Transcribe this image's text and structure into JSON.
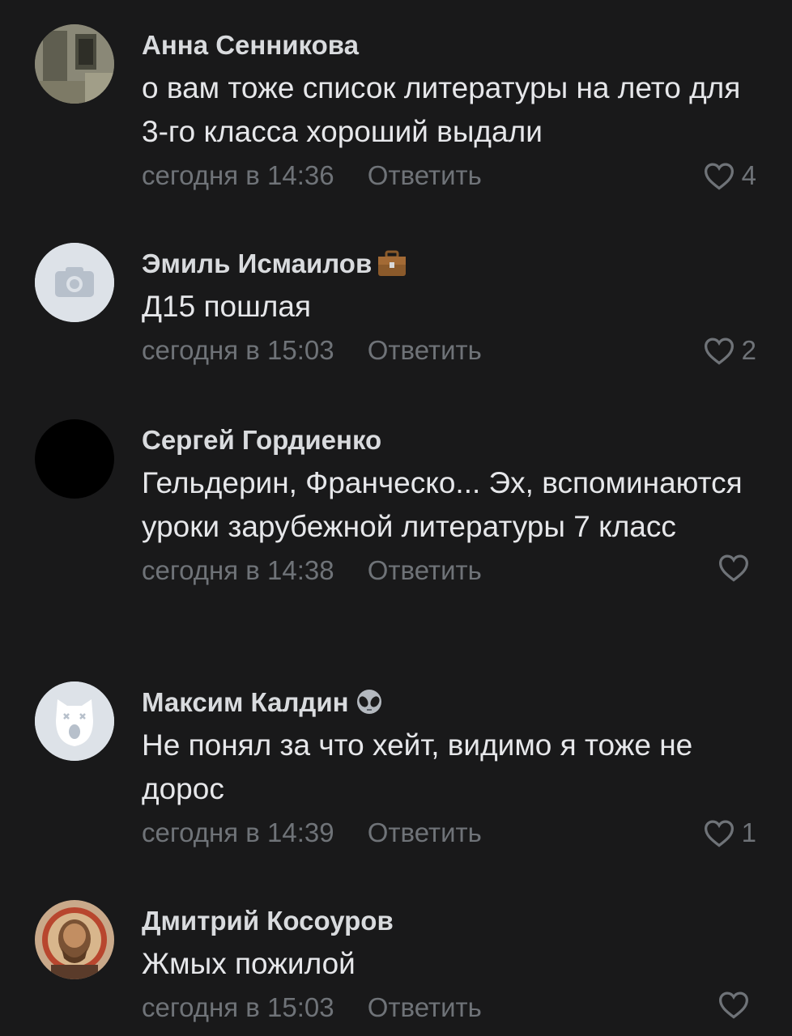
{
  "comments": [
    {
      "author": "Анна Сенникова",
      "text": "о вам тоже список литературы на лето для 3-го класса хороший выдали",
      "time": "сегодня в 14:36",
      "reply": "Ответить",
      "likes": "4",
      "avatar": "photo"
    },
    {
      "author": "Эмиль Исмаилов",
      "badge": "briefcase",
      "text": "Д15 пошлая",
      "time": "сегодня в 15:03",
      "reply": "Ответить",
      "likes": "2",
      "avatar": "camera-placeholder"
    },
    {
      "author": "Сергей Гордиенко",
      "text": "Гельдерин, Франческо... Эх, вспоминаются уроки зарубежной литературы 7 класс",
      "time": "сегодня в 14:38",
      "reply": "Ответить",
      "likes": "",
      "avatar": "black"
    },
    {
      "author": "Максим Калдин",
      "badge": "alien",
      "text": "Не понял за что хейт, видимо я тоже не дорос",
      "time": "сегодня в 14:39",
      "reply": "Ответить",
      "likes": "1",
      "avatar": "deactivated-dog"
    },
    {
      "author": "Дмитрий Косоуров",
      "text": "Жмых пожилой",
      "time": "сегодня в 15:03",
      "reply": "Ответить",
      "likes": "",
      "avatar": "fresco"
    }
  ],
  "colors": {
    "background": "#19191a",
    "author": "#d9dbde",
    "text": "#e6e7ea",
    "meta": "#6f7378"
  }
}
